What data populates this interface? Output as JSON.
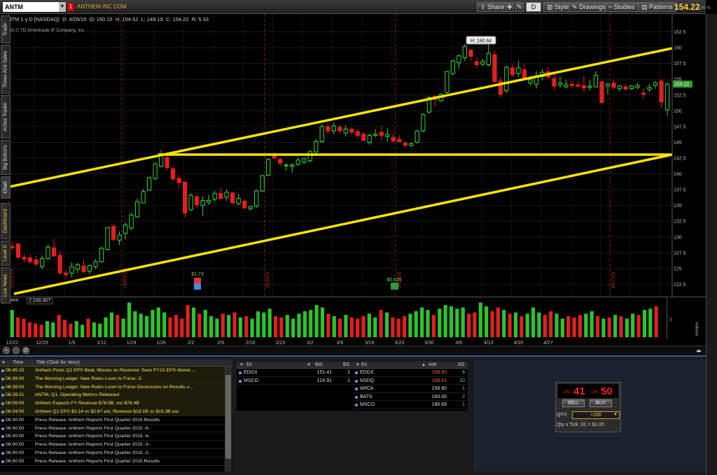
{
  "header": {
    "symbol": "ANTM",
    "link_badge": "1",
    "company_name": "ANTHEM INC COM",
    "buttons": {
      "share": "Share",
      "style": "Style",
      "drawings": "Drawings",
      "studies": "Studies",
      "patterns": "Patterns",
      "d": "D"
    },
    "last_price": "154.22",
    "pct_change": "0.00 %"
  },
  "chart_info": {
    "desc": "ANTM 1 y D [NASDAQ]",
    "date": "D: 4/28/15",
    "open": "O: 150.15",
    "high": "H: 154.52",
    "low": "L: 149.19",
    "close": "C: 154.22",
    "range": "R: 5.33",
    "copyright": "2015 © TD Ameritrade IP Company, Inc."
  },
  "price_axis": {
    "ticks": [
      "162.5",
      "160",
      "157.5",
      "155",
      "152.5",
      "150",
      "147.5",
      "145",
      "142.5",
      "140",
      "137.5",
      "135",
      "132.5",
      "130",
      "127.5",
      "125",
      "122.5"
    ],
    "current_label": "154.22"
  },
  "high_bubble": "H: 160.64",
  "events": [
    "12/19/14",
    "1/16/15",
    "2/20/15",
    "3/20/15",
    "4/17/15"
  ],
  "markers": {
    "div": "$1.73",
    "earn": "$0.625"
  },
  "date_labels": [
    "12/22",
    "12/29",
    "1/5",
    "1/12",
    "1/19",
    "1/26",
    "2/2",
    "2/9",
    "2/16",
    "2/23",
    "3/2",
    "3/9",
    "3/16",
    "3/23",
    "3/30",
    "4/6",
    "4/13",
    "4/20",
    "4/27"
  ],
  "volume": {
    "label": "Volume",
    "value": "2,249,467",
    "unit": "millions",
    "tick": "2"
  },
  "zoom": {
    "plus": "+",
    "minus": "-",
    "reset": "⊘"
  },
  "right_tabs": [
    "Trade",
    "Times And Sales",
    "Active Trader",
    "Big Buttons",
    "Chart",
    "Dashboard",
    "Level II",
    "Live News"
  ],
  "news": {
    "headers": {
      "time": "Time",
      "title": "Title (Click for story)"
    },
    "rows": [
      {
        "time": "06:45:15",
        "title": "Anthem Posts Q1 EPS Beat, Misses on Revenue; Sees FY15 EPS Above ..."
      },
      {
        "time": "06:39:00",
        "title": "The Morning Ledger: New Rules Loom to Force -2-"
      },
      {
        "time": "06:39:00",
        "title": "The Morning Ledger: New Rules Loom to Force Disclosures on Results v..."
      },
      {
        "time": "06:28:21",
        "title": "ANTM, Q1, Operating Metrics Released"
      },
      {
        "time": "06:09:00",
        "title": "Anthem Expects FY Revenue $78.5B, est $78.4B"
      },
      {
        "time": "06:04:00",
        "title": "Anthem Q1 EPS $3.14 vs $2.67 est, Revenue $19.1B vs $19.3B est"
      },
      {
        "time": "06:00:00",
        "title": "Press Release: Anthem Reports First Quarter 2015 Results"
      },
      {
        "time": "06:00:00",
        "title": "Press Release: Anthem Reports First Quarter 2015 -5-"
      },
      {
        "time": "06:00:00",
        "title": "Press Release: Anthem Reports First Quarter 2015 -4-"
      },
      {
        "time": "06:00:00",
        "title": "Press Release: Anthem Reports First Quarter 2015 -3-"
      },
      {
        "time": "06:00:00",
        "title": "Press Release: Anthem Reports First Quarter 2015 -2-"
      },
      {
        "time": "06:00:00",
        "title": "Press Release: Anthem Reports First Quarter 2015 Results"
      }
    ]
  },
  "bid_book": {
    "headers": {
      "ex": "Ex",
      "bid": "Bid",
      "bs": "BS"
    },
    "rows": [
      {
        "ex": "EDGX",
        "bid": "151.41",
        "bs": "1"
      },
      {
        "ex": "MSCO",
        "bid": "124.91",
        "bs": "1"
      }
    ]
  },
  "ask_book": {
    "headers": {
      "ex": "Ex",
      "ask": "Ask",
      "as": "AS"
    },
    "rows": [
      {
        "ex": "EDGX",
        "ask": "158.50",
        "as": "8"
      },
      {
        "ex": "NSDQ",
        "ask": "158.51",
        "as": "10"
      },
      {
        "ex": "ARCA",
        "ask": "158.80",
        "as": "1"
      },
      {
        "ex": "BATS",
        "ask": "160.00",
        "as": "2"
      },
      {
        "ex": "MSCO",
        "ask": "186.69",
        "as": "1"
      }
    ]
  },
  "ticket": {
    "bid_small": "151",
    "bid_big": "41",
    "ask_small": "158",
    "ask_big": "50",
    "sell": "SELL",
    "buy": "BUY",
    "qty_label": "QTY:",
    "qty": "+100",
    "tick_info": "Qty x Tick .01 = $1.00"
  },
  "chart_data": {
    "type": "candlestick",
    "title": "ANTM 1 y D [NASDAQ]",
    "ylim": [
      121,
      164
    ],
    "y_ticks": [
      122.5,
      125,
      127.5,
      130,
      132.5,
      135,
      137.5,
      140,
      142.5,
      145,
      147.5,
      150,
      152.5,
      155,
      157.5,
      160,
      162.5
    ],
    "candles": [
      [
        127.5,
        128.6,
        126.9,
        128.2
      ],
      [
        128.5,
        129.1,
        127.9,
        128.3
      ],
      [
        128.9,
        129.1,
        126.4,
        126.8
      ],
      [
        126.8,
        127.3,
        126.0,
        126.5
      ],
      [
        126.7,
        127.2,
        125.7,
        126.1
      ],
      [
        126.4,
        127.0,
        125.4,
        125.7
      ],
      [
        125.3,
        127.1,
        124.9,
        126.6
      ],
      [
        126.6,
        128.8,
        126.4,
        128.4
      ],
      [
        128.3,
        129.7,
        126.8,
        127.0
      ],
      [
        127.1,
        127.8,
        124.0,
        124.3
      ],
      [
        124.3,
        124.8,
        123.3,
        124.0
      ],
      [
        124.3,
        126.0,
        123.6,
        125.3
      ],
      [
        124.9,
        126.0,
        124.3,
        125.6
      ],
      [
        125.4,
        126.4,
        124.2,
        124.5
      ],
      [
        124.6,
        125.6,
        124.1,
        125.5
      ],
      [
        125.3,
        126.5,
        124.9,
        126.1
      ],
      [
        126.1,
        128.5,
        125.9,
        128.2
      ],
      [
        128.0,
        131.4,
        127.9,
        131.5
      ],
      [
        131.7,
        132.1,
        129.3,
        129.6
      ],
      [
        129.5,
        130.9,
        128.7,
        130.3
      ],
      [
        130.6,
        132.3,
        129.6,
        131.9
      ],
      [
        131.4,
        133.8,
        131.1,
        133.5
      ],
      [
        133.2,
        136.1,
        133.0,
        135.6
      ],
      [
        135.4,
        137.6,
        135.4,
        137.2
      ],
      [
        137.4,
        139.6,
        137.3,
        139.4
      ],
      [
        139.3,
        141.8,
        139.0,
        141.6
      ],
      [
        141.2,
        143.8,
        141.0,
        143.0
      ],
      [
        142.6,
        143.4,
        140.5,
        141.0
      ],
      [
        140.8,
        141.3,
        138.8,
        139.2
      ],
      [
        139.3,
        139.8,
        137.9,
        138.6
      ],
      [
        138.7,
        138.8,
        133.1,
        133.8
      ],
      [
        134.3,
        137.0,
        134.1,
        136.6
      ],
      [
        136.4,
        136.9,
        134.5,
        135.1
      ],
      [
        135.0,
        136.4,
        133.3,
        135.8
      ],
      [
        135.5,
        136.7,
        135.1,
        135.8
      ],
      [
        136.0,
        137.3,
        135.6,
        136.9
      ],
      [
        136.9,
        137.7,
        135.9,
        136.1
      ],
      [
        136.3,
        137.5,
        135.7,
        137.1
      ],
      [
        137.0,
        137.2,
        135.2,
        135.4
      ],
      [
        135.3,
        136.9,
        135.0,
        136.1
      ],
      [
        135.7,
        136.0,
        134.5,
        134.6
      ],
      [
        134.5,
        134.9,
        134.2,
        134.8
      ],
      [
        134.9,
        137.5,
        134.6,
        137.3
      ],
      [
        137.3,
        139.9,
        137.1,
        139.7
      ],
      [
        139.8,
        142.5,
        139.6,
        142.3
      ],
      [
        142.8,
        143.4,
        142.3,
        142.5
      ],
      [
        142.3,
        142.6,
        141.2,
        141.7
      ],
      [
        141.3,
        141.7,
        140.5,
        141.4
      ],
      [
        141.2,
        141.7,
        140.2,
        141.4
      ],
      [
        141.5,
        142.6,
        141.3,
        142.2
      ],
      [
        141.9,
        142.6,
        141.5,
        142.4
      ],
      [
        142.1,
        143.8,
        141.8,
        143.5
      ],
      [
        143.5,
        145.5,
        143.2,
        145.1
      ],
      [
        145.1,
        147.9,
        144.9,
        147.5
      ],
      [
        147.5,
        147.9,
        146.2,
        146.8
      ],
      [
        146.8,
        148.1,
        146.3,
        147.6
      ],
      [
        147.4,
        147.8,
        146.4,
        146.8
      ],
      [
        146.5,
        147.7,
        145.9,
        147.1
      ],
      [
        147.1,
        147.4,
        146.3,
        146.6
      ],
      [
        146.7,
        147.1,
        145.6,
        146.1
      ],
      [
        146.3,
        146.6,
        145.1,
        145.3
      ],
      [
        145.0,
        146.4,
        144.6,
        146.1
      ],
      [
        146.1,
        147.1,
        145.8,
        146.3
      ],
      [
        146.6,
        147.6,
        145.3,
        146.1
      ],
      [
        145.9,
        147.2,
        145.1,
        146.2
      ],
      [
        145.8,
        146.4,
        144.9,
        145.2
      ],
      [
        145.5,
        146.1,
        145.0,
        145.1
      ],
      [
        144.9,
        145.2,
        144.2,
        144.5
      ],
      [
        144.5,
        145.0,
        144.3,
        144.8
      ],
      [
        145.0,
        147.0,
        144.8,
        146.8
      ],
      [
        146.8,
        149.6,
        146.6,
        149.4
      ],
      [
        149.8,
        152.3,
        149.5,
        152.1
      ],
      [
        152.3,
        152.5,
        150.7,
        151.8
      ],
      [
        151.6,
        152.8,
        151.4,
        152.6
      ],
      [
        152.9,
        156.3,
        152.6,
        156.2
      ],
      [
        155.9,
        158.1,
        155.6,
        157.9
      ],
      [
        157.6,
        158.9,
        156.6,
        158.7
      ],
      [
        158.4,
        160.6,
        157.9,
        160.2
      ],
      [
        159.6,
        159.8,
        157.9,
        158.6
      ],
      [
        157.8,
        158.5,
        156.8,
        157.3
      ],
      [
        157.4,
        158.2,
        157.0,
        157.8
      ],
      [
        157.3,
        160.7,
        157.0,
        159.1
      ],
      [
        158.9,
        159.5,
        154.1,
        154.6
      ],
      [
        154.7,
        155.3,
        152.1,
        152.6
      ],
      [
        153.2,
        157.1,
        152.8,
        156.9
      ],
      [
        156.8,
        157.4,
        155.4,
        155.7
      ],
      [
        155.9,
        157.9,
        155.4,
        156.8
      ],
      [
        156.5,
        157.4,
        154.8,
        155.2
      ],
      [
        154.4,
        155.4,
        154.0,
        154.9
      ],
      [
        154.2,
        156.3,
        153.5,
        155.4
      ],
      [
        155.4,
        156.6,
        154.8,
        156.1
      ],
      [
        156.2,
        156.9,
        155.1,
        155.3
      ],
      [
        155.1,
        155.8,
        153.2,
        153.9
      ],
      [
        154.1,
        155.4,
        153.6,
        154.4
      ],
      [
        153.8,
        154.9,
        153.5,
        154.1
      ],
      [
        154.2,
        154.7,
        153.5,
        154.0
      ],
      [
        154.1,
        154.7,
        153.6,
        153.9
      ],
      [
        154.0,
        155.6,
        152.9,
        153.6
      ],
      [
        153.7,
        154.9,
        153.2,
        153.9
      ],
      [
        153.8,
        156.3,
        153.7,
        155.6
      ],
      [
        154.6,
        154.8,
        151.1,
        151.3
      ],
      [
        153.9,
        154.5,
        152.6,
        154.2
      ],
      [
        154.4,
        155.0,
        153.3,
        153.7
      ],
      [
        153.5,
        154.1,
        153.1,
        153.9
      ],
      [
        153.8,
        154.2,
        153.2,
        153.4
      ],
      [
        153.5,
        154.1,
        153.3,
        153.9
      ],
      [
        153.7,
        154.5,
        153.4,
        154.0
      ],
      [
        152.8,
        153.6,
        151.9,
        152.6
      ],
      [
        153.4,
        154.2,
        153.0,
        153.7
      ],
      [
        154.0,
        154.7,
        153.5,
        154.4
      ],
      [
        154.7,
        155.1,
        150.5,
        151.4
      ],
      [
        150.15,
        154.52,
        149.19,
        154.22
      ]
    ],
    "volume_millions": [
      2.2,
      1.6,
      1.5,
      1.2,
      1.1,
      1.0,
      1.3,
      1.2,
      1.8,
      1.4,
      1.1,
      1.3,
      1.0,
      1.5,
      1.2,
      1.1,
      1.6,
      2.0,
      1.8,
      1.5,
      2.8,
      2.1,
      1.9,
      1.7,
      2.2,
      2.4,
      2.0,
      1.6,
      1.8,
      1.5,
      2.6,
      2.4,
      1.9,
      2.2,
      1.7,
      1.5,
      1.9,
      1.8,
      2.0,
      1.6,
      1.7,
      1.5,
      2.1,
      2.0,
      2.3,
      1.7,
      1.6,
      1.8,
      1.5,
      1.9,
      2.1,
      2.2,
      2.6,
      2.4,
      1.9,
      1.7,
      1.5,
      1.8,
      1.6,
      1.5,
      1.7,
      1.9,
      1.6,
      2.2,
      2.0,
      1.6,
      1.5,
      1.7,
      1.9,
      2.1,
      2.4,
      2.2,
      1.8,
      2.3,
      2.6,
      2.5,
      2.3,
      2.4,
      1.9,
      2.0,
      2.8,
      2.5,
      2.1,
      2.4,
      2.2,
      1.9,
      2.0,
      1.7,
      1.9,
      2.4,
      2.0,
      1.8,
      2.1,
      1.9,
      1.5,
      1.7,
      1.6,
      1.8,
      1.9,
      2.1,
      1.7,
      1.5,
      1.6,
      1.8,
      1.7,
      1.5,
      1.9,
      1.8,
      2.2,
      2.3,
      2.5
    ]
  }
}
